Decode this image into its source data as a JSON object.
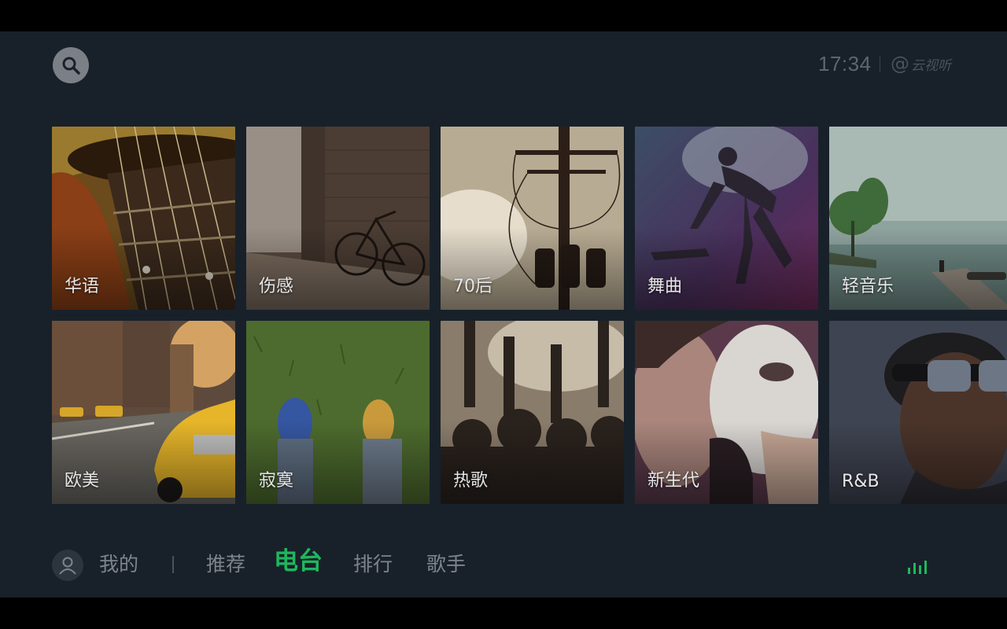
{
  "status": {
    "time": "17:34",
    "brand_symbol": "@",
    "brand_name": "云视听"
  },
  "search": {
    "icon": "search-icon"
  },
  "tiles": [
    {
      "label": "华语"
    },
    {
      "label": "伤感"
    },
    {
      "label": "70后"
    },
    {
      "label": "舞曲"
    },
    {
      "label": "轻音乐"
    },
    {
      "label": "欧美"
    },
    {
      "label": "寂寞"
    },
    {
      "label": "热歌"
    },
    {
      "label": "新生代"
    },
    {
      "label": "R&B"
    }
  ],
  "nav": {
    "my": "我的",
    "items": [
      {
        "label": "推荐"
      },
      {
        "label": "电台"
      },
      {
        "label": "排行"
      },
      {
        "label": "歌手"
      }
    ],
    "active_index": 1
  },
  "colors": {
    "accent": "#1fb75c",
    "background": "#18212a"
  },
  "now_playing": {
    "icon": "equalizer-icon"
  }
}
